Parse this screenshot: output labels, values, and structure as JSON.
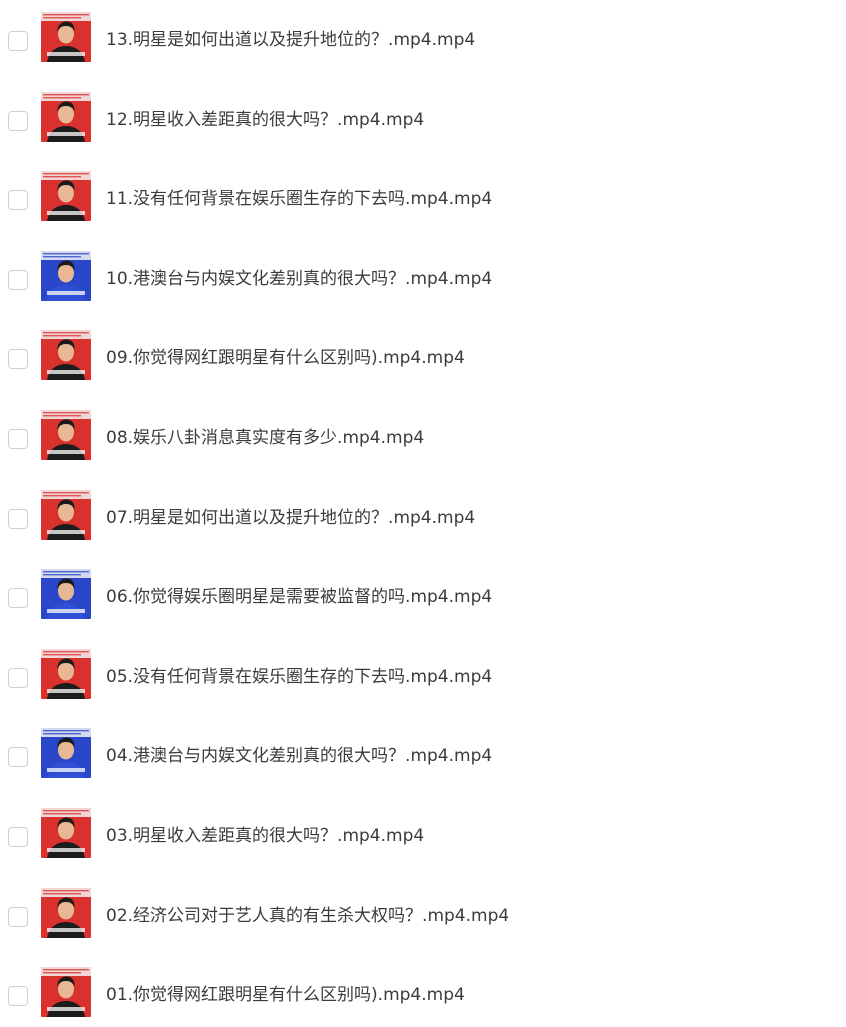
{
  "files": [
    {
      "name": "13.明星是如何出道以及提升地位的？.mp4.mp4",
      "thumb_variant": "red"
    },
    {
      "name": "12.明星收入差距真的很大吗？.mp4.mp4",
      "thumb_variant": "red"
    },
    {
      "name": "11.没有任何背景在娱乐圈生存的下去吗.mp4.mp4",
      "thumb_variant": "red"
    },
    {
      "name": "10.港澳台与内娱文化差别真的很大吗？.mp4.mp4",
      "thumb_variant": "blue"
    },
    {
      "name": "09.你觉得网红跟明星有什么区别吗).mp4.mp4",
      "thumb_variant": "red"
    },
    {
      "name": "08.娱乐八卦消息真实度有多少.mp4.mp4",
      "thumb_variant": "red"
    },
    {
      "name": "07.明星是如何出道以及提升地位的？.mp4.mp4",
      "thumb_variant": "red"
    },
    {
      "name": "06.你觉得娱乐圈明星是需要被监督的吗.mp4.mp4",
      "thumb_variant": "blue"
    },
    {
      "name": "05.没有任何背景在娱乐圈生存的下去吗.mp4.mp4",
      "thumb_variant": "red"
    },
    {
      "name": "04.港澳台与内娱文化差别真的很大吗？.mp4.mp4",
      "thumb_variant": "blue"
    },
    {
      "name": "03.明星收入差距真的很大吗？.mp4.mp4",
      "thumb_variant": "red"
    },
    {
      "name": "02.经济公司对于艺人真的有生杀大权吗？.mp4.mp4",
      "thumb_variant": "red"
    },
    {
      "name": "01.你觉得网红跟明星有什么区别吗).mp4.mp4",
      "thumb_variant": "red"
    }
  ],
  "colors": {
    "thumb_red": "#d9322e",
    "thumb_blue": "#2a47c9",
    "text": "#3b3b3b",
    "checkbox_border": "#cfcfcf"
  },
  "icons": {
    "checkbox": "checkbox-icon",
    "thumbnail": "video-thumbnail-icon"
  }
}
